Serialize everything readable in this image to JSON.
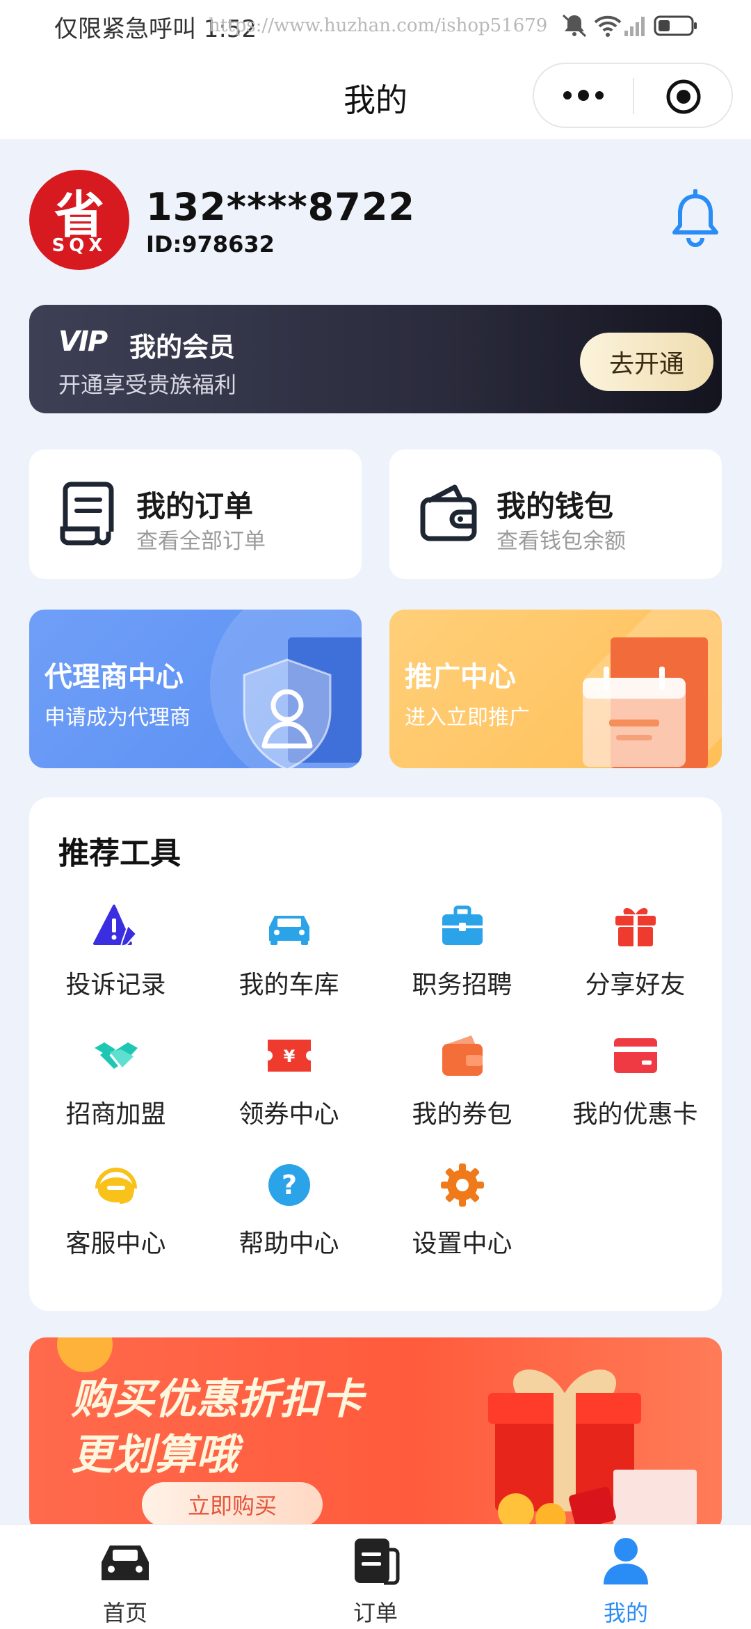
{
  "status_bar": {
    "left_text": "仅限紧急呼叫 1:52",
    "watermark": "https://www.huzhan.com/ishop51679"
  },
  "nav": {
    "title": "我的"
  },
  "profile": {
    "phone": "132****8722",
    "id": "ID:978632",
    "avatar_text": "省",
    "avatar_subtext": "SQX"
  },
  "vip": {
    "logo": "VIP",
    "title": "我的会员",
    "subtitle": "开通享受贵族福利",
    "button": "去开通"
  },
  "cards": [
    {
      "title": "我的订单",
      "subtitle": "查看全部订单",
      "icon": "receipt-icon"
    },
    {
      "title": "我的钱包",
      "subtitle": "查看钱包余额",
      "icon": "wallet-icon"
    }
  ],
  "banners": [
    {
      "title": "代理商中心",
      "subtitle": "申请成为代理商",
      "icon": "user-shield-icon"
    },
    {
      "title": "推广中心",
      "subtitle": "进入立即推广",
      "icon": "calendar-icon"
    }
  ],
  "tools": {
    "title": "推荐工具",
    "items": [
      {
        "label": "投诉记录",
        "icon": "complaint-icon",
        "color": "#3b2ee0"
      },
      {
        "label": "我的车库",
        "icon": "car-icon",
        "color": "#2aa3e8"
      },
      {
        "label": "职务招聘",
        "icon": "briefcase-icon",
        "color": "#2aa3e8"
      },
      {
        "label": "分享好友",
        "icon": "gift-icon",
        "color": "#ef3a2e"
      },
      {
        "label": "招商加盟",
        "icon": "handshake-icon",
        "color": "#1ec7b4"
      },
      {
        "label": "领券中心",
        "icon": "coupon-icon",
        "color": "#ef3a2e"
      },
      {
        "label": "我的券包",
        "icon": "coupon-wallet-icon",
        "color": "#f46e3a"
      },
      {
        "label": "我的优惠卡",
        "icon": "card-icon",
        "color": "#ef3a44"
      },
      {
        "label": "客服中心",
        "icon": "headset-icon",
        "color": "#f8c21a"
      },
      {
        "label": "帮助中心",
        "icon": "help-icon",
        "color": "#2aa3e8"
      },
      {
        "label": "设置中心",
        "icon": "gear-icon",
        "color": "#f07a1a"
      }
    ]
  },
  "promo_banner": {
    "line1": "购买优惠折扣卡",
    "line2": "更划算哦",
    "button": "立即购买"
  },
  "tabbar": {
    "items": [
      {
        "label": "首页",
        "icon": "car-home-icon",
        "active": false
      },
      {
        "label": "订单",
        "icon": "order-list-icon",
        "active": false
      },
      {
        "label": "我的",
        "icon": "person-icon",
        "active": true
      }
    ],
    "active_color": "#2a8cf5"
  }
}
